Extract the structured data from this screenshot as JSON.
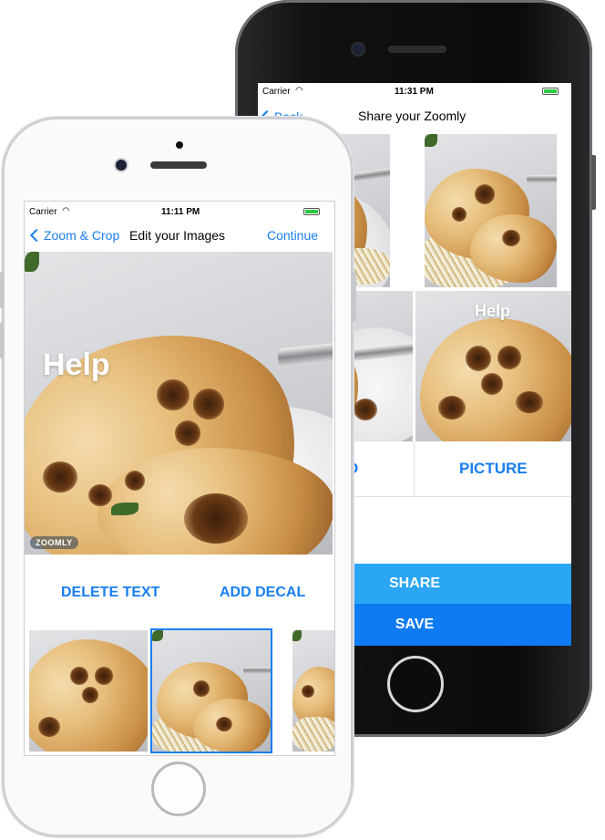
{
  "back_phone": {
    "status": {
      "carrier": "Carrier",
      "time": "11:31 PM"
    },
    "nav": {
      "back_label": "Back",
      "title": "Share your Zoomly"
    },
    "overlay_text": "Help",
    "grid_labels": [
      "D",
      "PICTURE"
    ],
    "buttons": {
      "share": "SHARE",
      "save": "SAVE"
    },
    "colors": {
      "share": "#2aa6f5",
      "save": "#0f7bf2",
      "accent": "#1a7ef0"
    }
  },
  "front_phone": {
    "status": {
      "carrier": "Carrier",
      "time": "11:11 PM"
    },
    "nav": {
      "back_label": "Zoom & Crop",
      "title": "Edit your Images",
      "action": "Continue"
    },
    "overlay_text": "Help",
    "watermark": "ZOOMLY",
    "actions": {
      "delete_text": "DELETE TEXT",
      "add_decal": "ADD DECAL"
    },
    "colors": {
      "accent": "#1a7ef0"
    }
  }
}
